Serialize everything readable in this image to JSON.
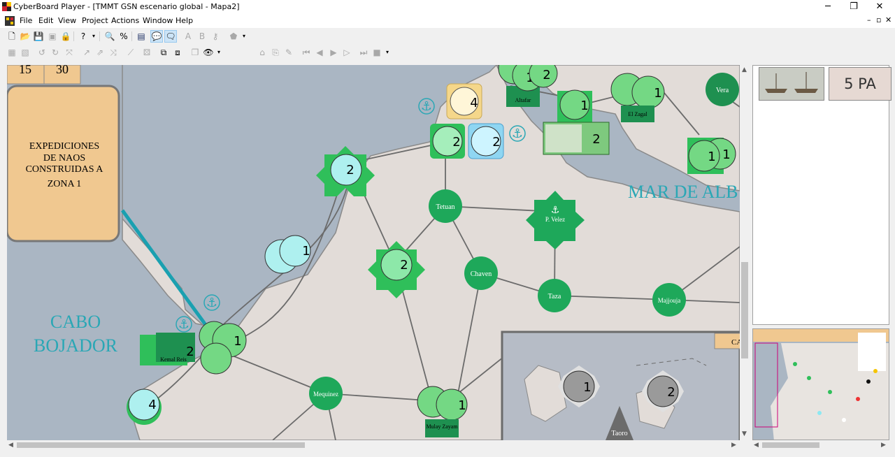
{
  "window": {
    "title": "CyberBoard Player - [TMMT GSN escenario global - Mapa2]",
    "minimize": "─",
    "maximize": "❐",
    "close": "✕"
  },
  "menu": [
    "File",
    "Edit",
    "View",
    "Project",
    "Actions",
    "Window",
    "Help"
  ],
  "mdi_controls": [
    "–",
    "▫",
    "✕"
  ],
  "map": {
    "track_numbers": [
      "15",
      "30"
    ],
    "box_text": [
      "EXPEDICIONES",
      "DE NAOS",
      "CONSTRUIDAS A",
      "ZONA 1"
    ],
    "sea_label": "MAR DE ALB",
    "cape_label": [
      "CABO",
      "BOJADOR"
    ],
    "cities": {
      "tetuan": "Tetuan",
      "velez": "P. Velez",
      "chaven": "Chaven",
      "taza": "Taza",
      "majjouja": "Majjouja",
      "mequinez": "Mequinez",
      "vera": "Vera",
      "taoro": "Taoro"
    },
    "leaders": {
      "altafar": "Altafar",
      "el_zagal": "El Zagal",
      "kemal": "Kemal Reis",
      "mulay": "Mulay Zayam"
    },
    "ship_value": "2",
    "inset_label": "CA",
    "stack_values": {
      "yellow": "4",
      "tetuan_green": "2",
      "tetuan_blue": "2",
      "north_star": "2",
      "west_horse": "1",
      "mid_star": "2",
      "cabo": "1",
      "kemal": "2",
      "sw": "4",
      "mulay": "1",
      "altafar1": "1",
      "altafar2": "2",
      "zagal_stack": "1",
      "sel_center": "1",
      "right_top": "1",
      "right_bot": "1",
      "inset1": "1",
      "inset2": "2"
    }
  },
  "tray": {
    "points": "5 PA"
  },
  "colors": {
    "sea": "#aab6c3",
    "land": "#e2dcd8",
    "city": "#1ea85a",
    "road": "#6b6b6b",
    "sea_text": "#2aa7b5",
    "box": "#f0c890"
  }
}
